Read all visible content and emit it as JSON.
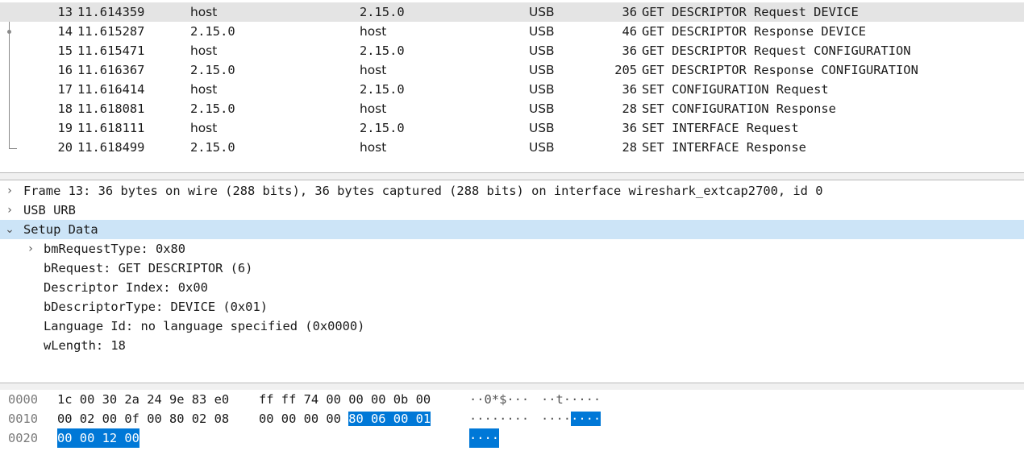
{
  "packet_list": {
    "rows": [
      {
        "no": "13",
        "time": "11.614359",
        "source": "host",
        "destination": "2.15.0",
        "protocol": "USB",
        "length": "36",
        "info": "GET DESCRIPTOR Request DEVICE",
        "selected": true
      },
      {
        "no": "14",
        "time": "11.615287",
        "source": "2.15.0",
        "destination": "host",
        "protocol": "USB",
        "length": "46",
        "info": "GET DESCRIPTOR Response DEVICE"
      },
      {
        "no": "15",
        "time": "11.615471",
        "source": "host",
        "destination": "2.15.0",
        "protocol": "USB",
        "length": "36",
        "info": "GET DESCRIPTOR Request CONFIGURATION"
      },
      {
        "no": "16",
        "time": "11.616367",
        "source": "2.15.0",
        "destination": "host",
        "protocol": "USB",
        "length": "205",
        "info": "GET DESCRIPTOR Response CONFIGURATION"
      },
      {
        "no": "17",
        "time": "11.616414",
        "source": "host",
        "destination": "2.15.0",
        "protocol": "USB",
        "length": "36",
        "info": "SET CONFIGURATION Request"
      },
      {
        "no": "18",
        "time": "11.618081",
        "source": "2.15.0",
        "destination": "host",
        "protocol": "USB",
        "length": "28",
        "info": "SET CONFIGURATION Response"
      },
      {
        "no": "19",
        "time": "11.618111",
        "source": "host",
        "destination": "2.15.0",
        "protocol": "USB",
        "length": "36",
        "info": "SET INTERFACE Request"
      },
      {
        "no": "20",
        "time": "11.618499",
        "source": "2.15.0",
        "destination": "host",
        "protocol": "USB",
        "length": "28",
        "info": "SET INTERFACE Response"
      }
    ]
  },
  "details": {
    "frame": "Frame 13: 36 bytes on wire (288 bits), 36 bytes captured (288 bits) on interface wireshark_extcap2700, id 0",
    "usb_urb": "USB URB",
    "setup_data": "Setup Data",
    "bmRequestType": "bmRequestType: 0x80",
    "bRequest": "bRequest: GET DESCRIPTOR (6)",
    "descriptor_index": "Descriptor Index: 0x00",
    "bDescriptorType": "bDescriptorType: DEVICE (0x01)",
    "language_id": "Language Id: no language specified (0x0000)",
    "wLength": "wLength: 18"
  },
  "bytes": {
    "row0": {
      "offset": "0000",
      "hex1": "1c 00 30 2a 24 9e 83 e0",
      "hex2": "ff ff 74 00 00 00 0b 00",
      "ascii1": "··0*$···",
      "ascii2": "··t·····"
    },
    "row1": {
      "offset": "0010",
      "hex1": "00 02 00 0f 00 80 02 08",
      "hex2a": "00 00 00 00 ",
      "hex2b": "80 06 00 01",
      "ascii1": "········",
      "ascii2a": "····",
      "ascii2b": "····"
    },
    "row2": {
      "offset": "0020",
      "hex1": "00 00 12 00",
      "ascii1": "····"
    }
  },
  "colors": {
    "selected_packet_bg": "#e4e4e4",
    "selected_tree_bg": "#cce4f7",
    "byte_highlight_bg": "#0078d7"
  }
}
